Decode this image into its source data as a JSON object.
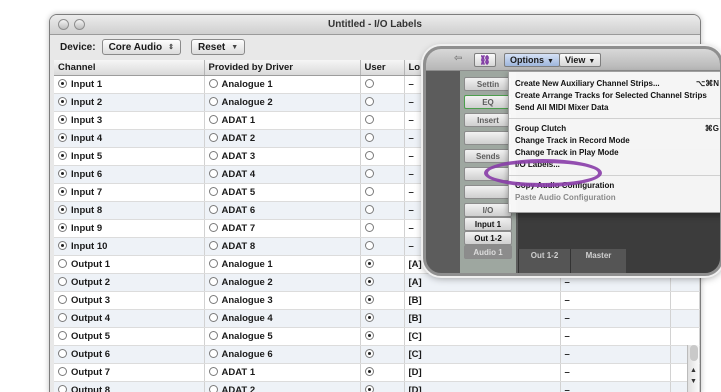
{
  "window": {
    "title": "Untitled - I/O Labels"
  },
  "toolbar": {
    "device_label": "Device:",
    "device_value": "Core Audio",
    "reset_label": "Reset"
  },
  "columns": [
    "Channel",
    "Provided by Driver",
    "User",
    "Lo",
    "",
    ""
  ],
  "rows": [
    {
      "channel": "Input 1",
      "driver": "Analogue 1",
      "label": "–"
    },
    {
      "channel": "Input 2",
      "driver": "Analogue 2",
      "label": "–"
    },
    {
      "channel": "Input 3",
      "driver": "ADAT 1",
      "label": "–"
    },
    {
      "channel": "Input 4",
      "driver": "ADAT 2",
      "label": "–"
    },
    {
      "channel": "Input 5",
      "driver": "ADAT 3",
      "label": "–"
    },
    {
      "channel": "Input 6",
      "driver": "ADAT 4",
      "label": "–"
    },
    {
      "channel": "Input 7",
      "driver": "ADAT 5",
      "label": "–"
    },
    {
      "channel": "Input 8",
      "driver": "ADAT 6",
      "label": "–"
    },
    {
      "channel": "Input 9",
      "driver": "ADAT 7",
      "label": "–"
    },
    {
      "channel": "Input 10",
      "driver": "ADAT 8",
      "label": "–"
    },
    {
      "channel": "Output 1",
      "driver": "Analogue 1",
      "label": "[A]",
      "short": "–"
    },
    {
      "channel": "Output 2",
      "driver": "Analogue 2",
      "label": "[A]",
      "short": "–"
    },
    {
      "channel": "Output 3",
      "driver": "Analogue 3",
      "label": "[B]",
      "short": "–"
    },
    {
      "channel": "Output 4",
      "driver": "Analogue 4",
      "label": "[B]",
      "short": "–"
    },
    {
      "channel": "Output 5",
      "driver": "Analogue 5",
      "label": "[C]",
      "short": "–"
    },
    {
      "channel": "Output 6",
      "driver": "Analogue 6",
      "label": "[C]",
      "short": "–"
    },
    {
      "channel": "Output 7",
      "driver": "ADAT 1",
      "label": "[D]",
      "short": "–"
    },
    {
      "channel": "Output 8",
      "driver": "ADAT 2",
      "label": "[D]",
      "short": "–"
    }
  ],
  "mixer": {
    "options_label": "Options",
    "view_label": "View",
    "strip_buttons": [
      "Settin",
      "EQ",
      "Insert",
      "Sends",
      "I/O",
      "Input 1",
      "Out 1-2",
      "Audio 1"
    ],
    "bottom_labels": [
      "Out 1-2",
      "Master"
    ]
  },
  "menu": {
    "items": [
      {
        "label": "Create New Auxiliary Channel Strips...",
        "shortcut": "⌥⌘N"
      },
      {
        "label": "Create Arrange Tracks for Selected Channel Strips",
        "shortcut": ""
      },
      {
        "label": "Send All MIDI Mixer Data",
        "shortcut": ""
      },
      {
        "label": "Group Clutch",
        "shortcut": "⌘G"
      },
      {
        "label": "Change Track in Record Mode",
        "shortcut": ""
      },
      {
        "label": "Change Track in Play Mode",
        "shortcut": ""
      },
      {
        "label": "I/O Labels...",
        "shortcut": ""
      },
      {
        "label": "Copy Audio Configuration",
        "shortcut": ""
      },
      {
        "label": "Paste Audio Configuration",
        "shortcut": ""
      }
    ]
  },
  "colors": {
    "highlight_ring": "#8a3fa9",
    "selected_menu": "#a9bde0"
  }
}
